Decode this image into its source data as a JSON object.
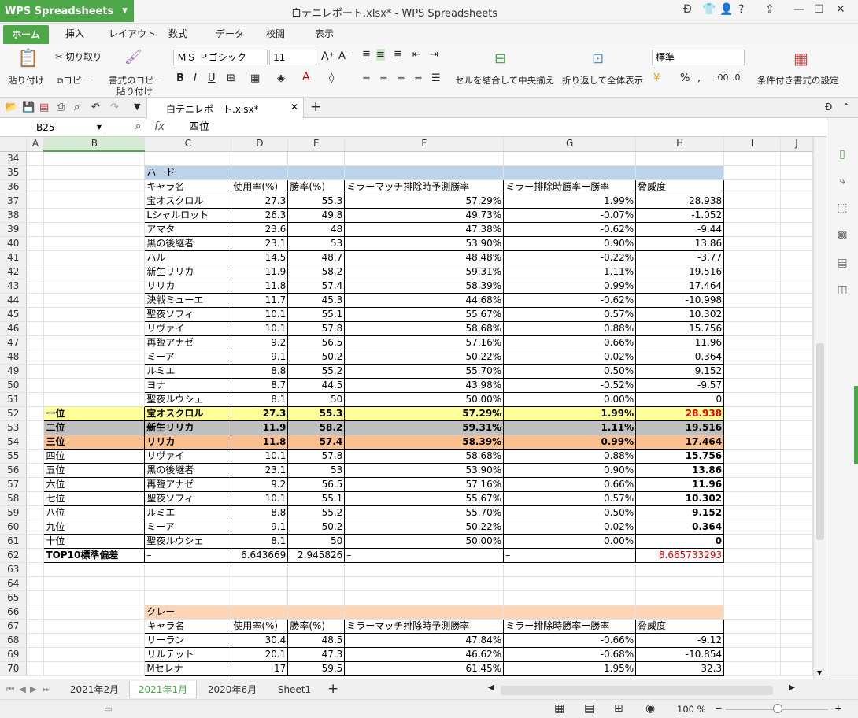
{
  "app": {
    "name": "WPS Spreadsheets",
    "title": "白テニレポート.xlsx* - WPS Spreadsheets",
    "doc_tab": "白テニレポート.xlsx*"
  },
  "ribbon_tabs": [
    "ホーム",
    "挿入",
    "レイアウト",
    "数式",
    "データ",
    "校閲",
    "表示"
  ],
  "ribbon": {
    "paste": "貼り付け",
    "cut": "切り取り",
    "copy": "コピー",
    "format_painter": "書式のコピー",
    "format_painter2": "貼り付け",
    "font": "ＭＳ Ｐゴシック",
    "size": "11",
    "bold": "B",
    "italic": "I",
    "underline": "U",
    "merge": "セルを結合して中央揃え",
    "wrap": "折り返して全体表示",
    "number_format": "標準",
    "percent": "%",
    "conditional": "条件付き書式の設定"
  },
  "formula": {
    "cell": "B25",
    "fx": "fx",
    "value": "四位"
  },
  "columns": [
    "A",
    "B",
    "C",
    "D",
    "E",
    "F",
    "G",
    "H",
    "I",
    "J"
  ],
  "rows": [
    {
      "n": "34",
      "c": []
    },
    {
      "n": "35",
      "s": "hdr-blue",
      "c": [
        "",
        "",
        "ハード",
        "",
        "",
        "",
        "",
        ""
      ]
    },
    {
      "n": "36",
      "s": "thead",
      "c": [
        "",
        "",
        "キャラ名",
        "使用率(%)",
        "勝率(%)",
        "ミラーマッチ排除時予測勝率",
        "ミラー排除時勝率ー勝率",
        "脅威度"
      ]
    },
    {
      "n": "37",
      "s": "data",
      "c": [
        "",
        "",
        "宝オスクロル",
        "27.3",
        "55.3",
        "57.29%",
        "1.99%",
        "28.938"
      ]
    },
    {
      "n": "38",
      "s": "data",
      "c": [
        "",
        "",
        "Lシャルロット",
        "26.3",
        "49.8",
        "49.73%",
        "-0.07%",
        "-1.052"
      ]
    },
    {
      "n": "39",
      "s": "data",
      "c": [
        "",
        "",
        "アマタ",
        "23.6",
        "48",
        "47.38%",
        "-0.62%",
        "-9.44"
      ]
    },
    {
      "n": "40",
      "s": "data",
      "c": [
        "",
        "",
        "黒の後継者",
        "23.1",
        "53",
        "53.90%",
        "0.90%",
        "13.86"
      ]
    },
    {
      "n": "41",
      "s": "data",
      "c": [
        "",
        "",
        "ハル",
        "14.5",
        "48.7",
        "48.48%",
        "-0.22%",
        "-3.77"
      ]
    },
    {
      "n": "42",
      "s": "data",
      "c": [
        "",
        "",
        "新生リリカ",
        "11.9",
        "58.2",
        "59.31%",
        "1.11%",
        "19.516"
      ]
    },
    {
      "n": "43",
      "s": "data",
      "c": [
        "",
        "",
        "リリカ",
        "11.8",
        "57.4",
        "58.39%",
        "0.99%",
        "17.464"
      ]
    },
    {
      "n": "44",
      "s": "data",
      "c": [
        "",
        "",
        "決戦ミューエ",
        "11.7",
        "45.3",
        "44.68%",
        "-0.62%",
        "-10.998"
      ]
    },
    {
      "n": "45",
      "s": "data",
      "c": [
        "",
        "",
        "聖夜ソフィ",
        "10.1",
        "55.1",
        "55.67%",
        "0.57%",
        "10.302"
      ]
    },
    {
      "n": "46",
      "s": "data",
      "c": [
        "",
        "",
        "リヴァイ",
        "10.1",
        "57.8",
        "58.68%",
        "0.88%",
        "15.756"
      ]
    },
    {
      "n": "47",
      "s": "data",
      "c": [
        "",
        "",
        "再臨アナゼ",
        "9.2",
        "56.5",
        "57.16%",
        "0.66%",
        "11.96"
      ]
    },
    {
      "n": "48",
      "s": "data",
      "c": [
        "",
        "",
        "ミーア",
        "9.1",
        "50.2",
        "50.22%",
        "0.02%",
        "0.364"
      ]
    },
    {
      "n": "49",
      "s": "data",
      "c": [
        "",
        "",
        "ルミエ",
        "8.8",
        "55.2",
        "55.70%",
        "0.50%",
        "9.152"
      ]
    },
    {
      "n": "50",
      "s": "data",
      "c": [
        "",
        "",
        "ヨナ",
        "8.7",
        "44.5",
        "43.98%",
        "-0.52%",
        "-9.57"
      ]
    },
    {
      "n": "51",
      "s": "data",
      "c": [
        "",
        "",
        "聖夜ルウシェ",
        "8.1",
        "50",
        "50.00%",
        "0.00%",
        "0"
      ]
    },
    {
      "n": "52",
      "s": "rank1",
      "c": [
        "",
        "一位",
        "宝オスクロル",
        "27.3",
        "55.3",
        "57.29%",
        "1.99%",
        "28.938"
      ]
    },
    {
      "n": "53",
      "s": "rank2",
      "c": [
        "",
        "二位",
        "新生リリカ",
        "11.9",
        "58.2",
        "59.31%",
        "1.11%",
        "19.516"
      ]
    },
    {
      "n": "54",
      "s": "rank3",
      "c": [
        "",
        "三位",
        "リリカ",
        "11.8",
        "57.4",
        "58.39%",
        "0.99%",
        "17.464"
      ]
    },
    {
      "n": "55",
      "s": "rank",
      "c": [
        "",
        "四位",
        "リヴァイ",
        "10.1",
        "57.8",
        "58.68%",
        "0.88%",
        "15.756"
      ]
    },
    {
      "n": "56",
      "s": "rank",
      "c": [
        "",
        "五位",
        "黒の後継者",
        "23.1",
        "53",
        "53.90%",
        "0.90%",
        "13.86"
      ]
    },
    {
      "n": "57",
      "s": "rank",
      "c": [
        "",
        "六位",
        "再臨アナゼ",
        "9.2",
        "56.5",
        "57.16%",
        "0.66%",
        "11.96"
      ]
    },
    {
      "n": "58",
      "s": "rank",
      "c": [
        "",
        "七位",
        "聖夜ソフィ",
        "10.1",
        "55.1",
        "55.67%",
        "0.57%",
        "10.302"
      ]
    },
    {
      "n": "59",
      "s": "rank",
      "c": [
        "",
        "八位",
        "ルミエ",
        "8.8",
        "55.2",
        "55.70%",
        "0.50%",
        "9.152"
      ]
    },
    {
      "n": "60",
      "s": "rank",
      "c": [
        "",
        "九位",
        "ミーア",
        "9.1",
        "50.2",
        "50.22%",
        "0.02%",
        "0.364"
      ]
    },
    {
      "n": "61",
      "s": "rank",
      "c": [
        "",
        "十位",
        "聖夜ルウシェ",
        "8.1",
        "50",
        "50.00%",
        "0.00%",
        "0"
      ]
    },
    {
      "n": "62",
      "s": "std",
      "c": [
        "",
        "TOP10標準偏差",
        "–",
        "6.643669",
        "2.945826",
        "–",
        "–",
        "8.665733293"
      ]
    },
    {
      "n": "63",
      "c": []
    },
    {
      "n": "64",
      "c": []
    },
    {
      "n": "65",
      "c": []
    },
    {
      "n": "66",
      "s": "hdr-orange",
      "c": [
        "",
        "",
        "クレー",
        "",
        "",
        "",
        "",
        ""
      ]
    },
    {
      "n": "67",
      "s": "thead2",
      "c": [
        "",
        "",
        "キャラ名",
        "使用率(%)",
        "勝率(%)",
        "ミラーマッチ排除時予測勝率",
        "ミラー排除時勝率ー勝率",
        "脅威度"
      ]
    },
    {
      "n": "68",
      "s": "data",
      "c": [
        "",
        "",
        "リーラン",
        "30.4",
        "48.5",
        "47.84%",
        "-0.66%",
        "-9.12"
      ]
    },
    {
      "n": "69",
      "s": "data",
      "c": [
        "",
        "",
        "リルテット",
        "20.1",
        "47.3",
        "46.62%",
        "-0.68%",
        "-10.854"
      ]
    },
    {
      "n": "70",
      "s": "data",
      "c": [
        "",
        "",
        "Mセレナ",
        "17",
        "59.5",
        "61.45%",
        "1.95%",
        "32.3"
      ]
    }
  ],
  "sheets": [
    "2021年2月",
    "2021年1月",
    "2020年6月",
    "Sheet1"
  ],
  "active_sheet": "2021年1月",
  "zoom": "100 %",
  "colors": {
    "accent": "#4ea84a",
    "rank1": "#ffff99",
    "rank2": "#c0c0c0",
    "rank3": "#fac090",
    "hard": "#bcd3ea",
    "clay": "#fbd5b5"
  }
}
